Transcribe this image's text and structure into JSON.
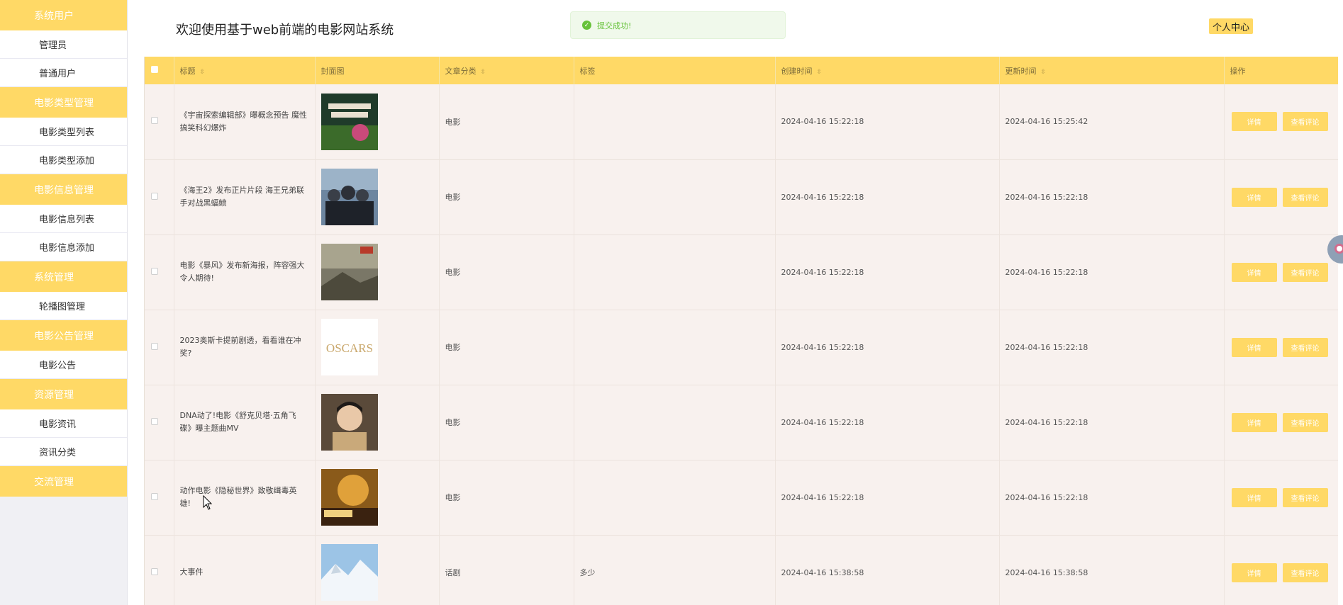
{
  "header": {
    "title": "欢迎使用基于web前端的电影网站系统",
    "profile_label": "个人中心",
    "toast": {
      "message": "提交成功!",
      "icon": "check-circle-icon"
    }
  },
  "sidebar": {
    "groups": [
      {
        "label": "系统用户",
        "items": [
          "管理员",
          "普通用户"
        ]
      },
      {
        "label": "电影类型管理",
        "items": [
          "电影类型列表",
          "电影类型添加"
        ]
      },
      {
        "label": "电影信息管理",
        "items": [
          "电影信息列表",
          "电影信息添加"
        ]
      },
      {
        "label": "系统管理",
        "items": [
          "轮播图管理"
        ]
      },
      {
        "label": "电影公告管理",
        "items": [
          "电影公告"
        ]
      },
      {
        "label": "资源管理",
        "items": [
          "电影资讯",
          "资讯分类"
        ]
      },
      {
        "label": "交流管理",
        "items": []
      }
    ]
  },
  "table": {
    "columns": [
      "标题",
      "封面图",
      "文章分类",
      "标签",
      "创建时间",
      "更新时间",
      "操作"
    ],
    "detail_label": "详情",
    "comment_label": "查看评论",
    "rows": [
      {
        "title": "《宇宙探索编辑部》曝概念预告 魔性搞笑科幻爆炸",
        "cover": "poster-journey",
        "category": "电影",
        "tag": "",
        "created": "2024-04-16 15:22:18",
        "updated": "2024-04-16 15:25:42"
      },
      {
        "title": "《海王2》发布正片片段 海王兄弟联手对战黑蝠鲼",
        "cover": "poster-group",
        "category": "电影",
        "tag": "",
        "created": "2024-04-16 15:22:18",
        "updated": "2024-04-16 15:22:18"
      },
      {
        "title": "电影《暴风》发布新海报，阵容强大令人期待!",
        "cover": "poster-storm",
        "category": "电影",
        "tag": "",
        "created": "2024-04-16 15:22:18",
        "updated": "2024-04-16 15:22:18"
      },
      {
        "title": "2023奥斯卡提前剧透，看看谁在冲奖?",
        "cover": "poster-oscars",
        "category": "电影",
        "tag": "",
        "created": "2024-04-16 15:22:18",
        "updated": "2024-04-16 15:22:18"
      },
      {
        "title": "DNA动了!电影《舒克贝塔·五角飞碟》曝主题曲MV",
        "cover": "poster-portrait",
        "category": "电影",
        "tag": "",
        "created": "2024-04-16 15:22:18",
        "updated": "2024-04-16 15:22:18"
      },
      {
        "title": "动作电影《隐秘世界》致敬缉毒英雄!",
        "cover": "poster-hidden",
        "category": "电影",
        "tag": "",
        "created": "2024-04-16 15:22:18",
        "updated": "2024-04-16 15:22:18"
      },
      {
        "title": "大事件",
        "cover": "poster-snow",
        "category": "话剧",
        "tag": "多少",
        "created": "2024-04-16 15:38:58",
        "updated": "2024-04-16 15:38:58"
      }
    ]
  },
  "oscars_text": "OSCARS",
  "colors": {
    "accent": "#ffd966",
    "row_bg": "#f8f1ee",
    "toast_green": "#67c23a"
  }
}
